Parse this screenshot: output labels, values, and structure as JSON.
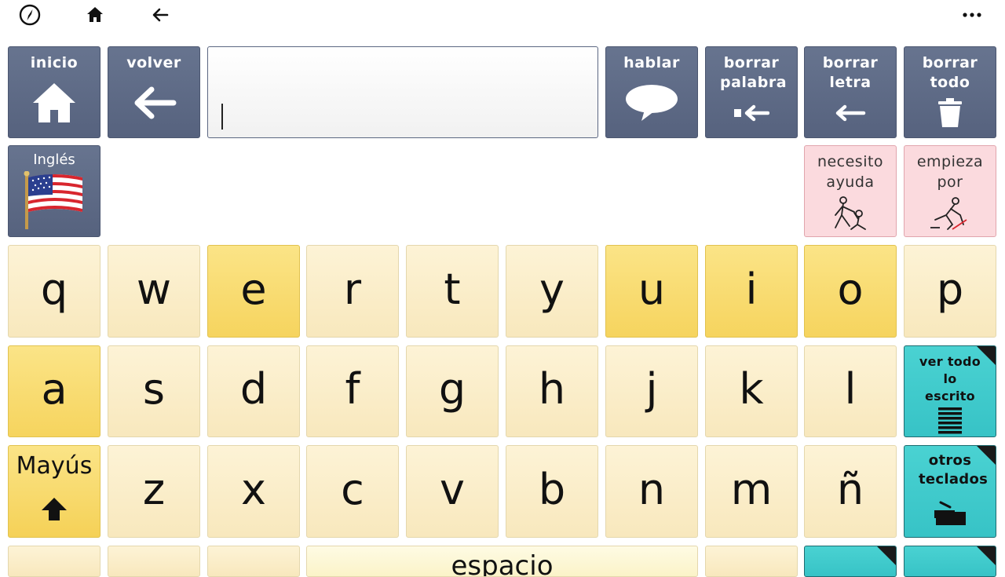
{
  "topbar": {
    "icons": [
      "compass-icon",
      "home-icon",
      "back-arrow-icon",
      "more-icon"
    ]
  },
  "toolbar": {
    "home_label": "inicio",
    "back_label": "volver",
    "speak_label": "hablar",
    "delete_word_label": "borrar palabra",
    "delete_letter_label": "borrar letra",
    "delete_all_label": "borrar todo"
  },
  "message": {
    "value": ""
  },
  "language": {
    "label": "Inglés",
    "icon": "us-flag-icon"
  },
  "phrases": [
    {
      "label": "necesito ayuda",
      "icon": "need-help-pictogram-icon"
    },
    {
      "label": "empieza por",
      "icon": "starts-with-pictogram-icon"
    }
  ],
  "keyboard": {
    "row1": [
      "q",
      "w",
      "e",
      "r",
      "t",
      "y",
      "u",
      "i",
      "o",
      "p"
    ],
    "row2": [
      "a",
      "s",
      "d",
      "f",
      "g",
      "h",
      "j",
      "k",
      "l"
    ],
    "row3": [
      "z",
      "x",
      "c",
      "v",
      "b",
      "n",
      "m",
      "ñ"
    ],
    "shift_label": "Mayús",
    "space_label": "espacio",
    "see_all_label": "ver todo lo escrito",
    "other_keyboards_label": "otros teclados"
  },
  "colors": {
    "toolbar": "#5e6a86",
    "key": "#fcefcc",
    "vowel": "#f9dc74",
    "phrase": "#fbdade",
    "teal": "#40cbcd"
  }
}
